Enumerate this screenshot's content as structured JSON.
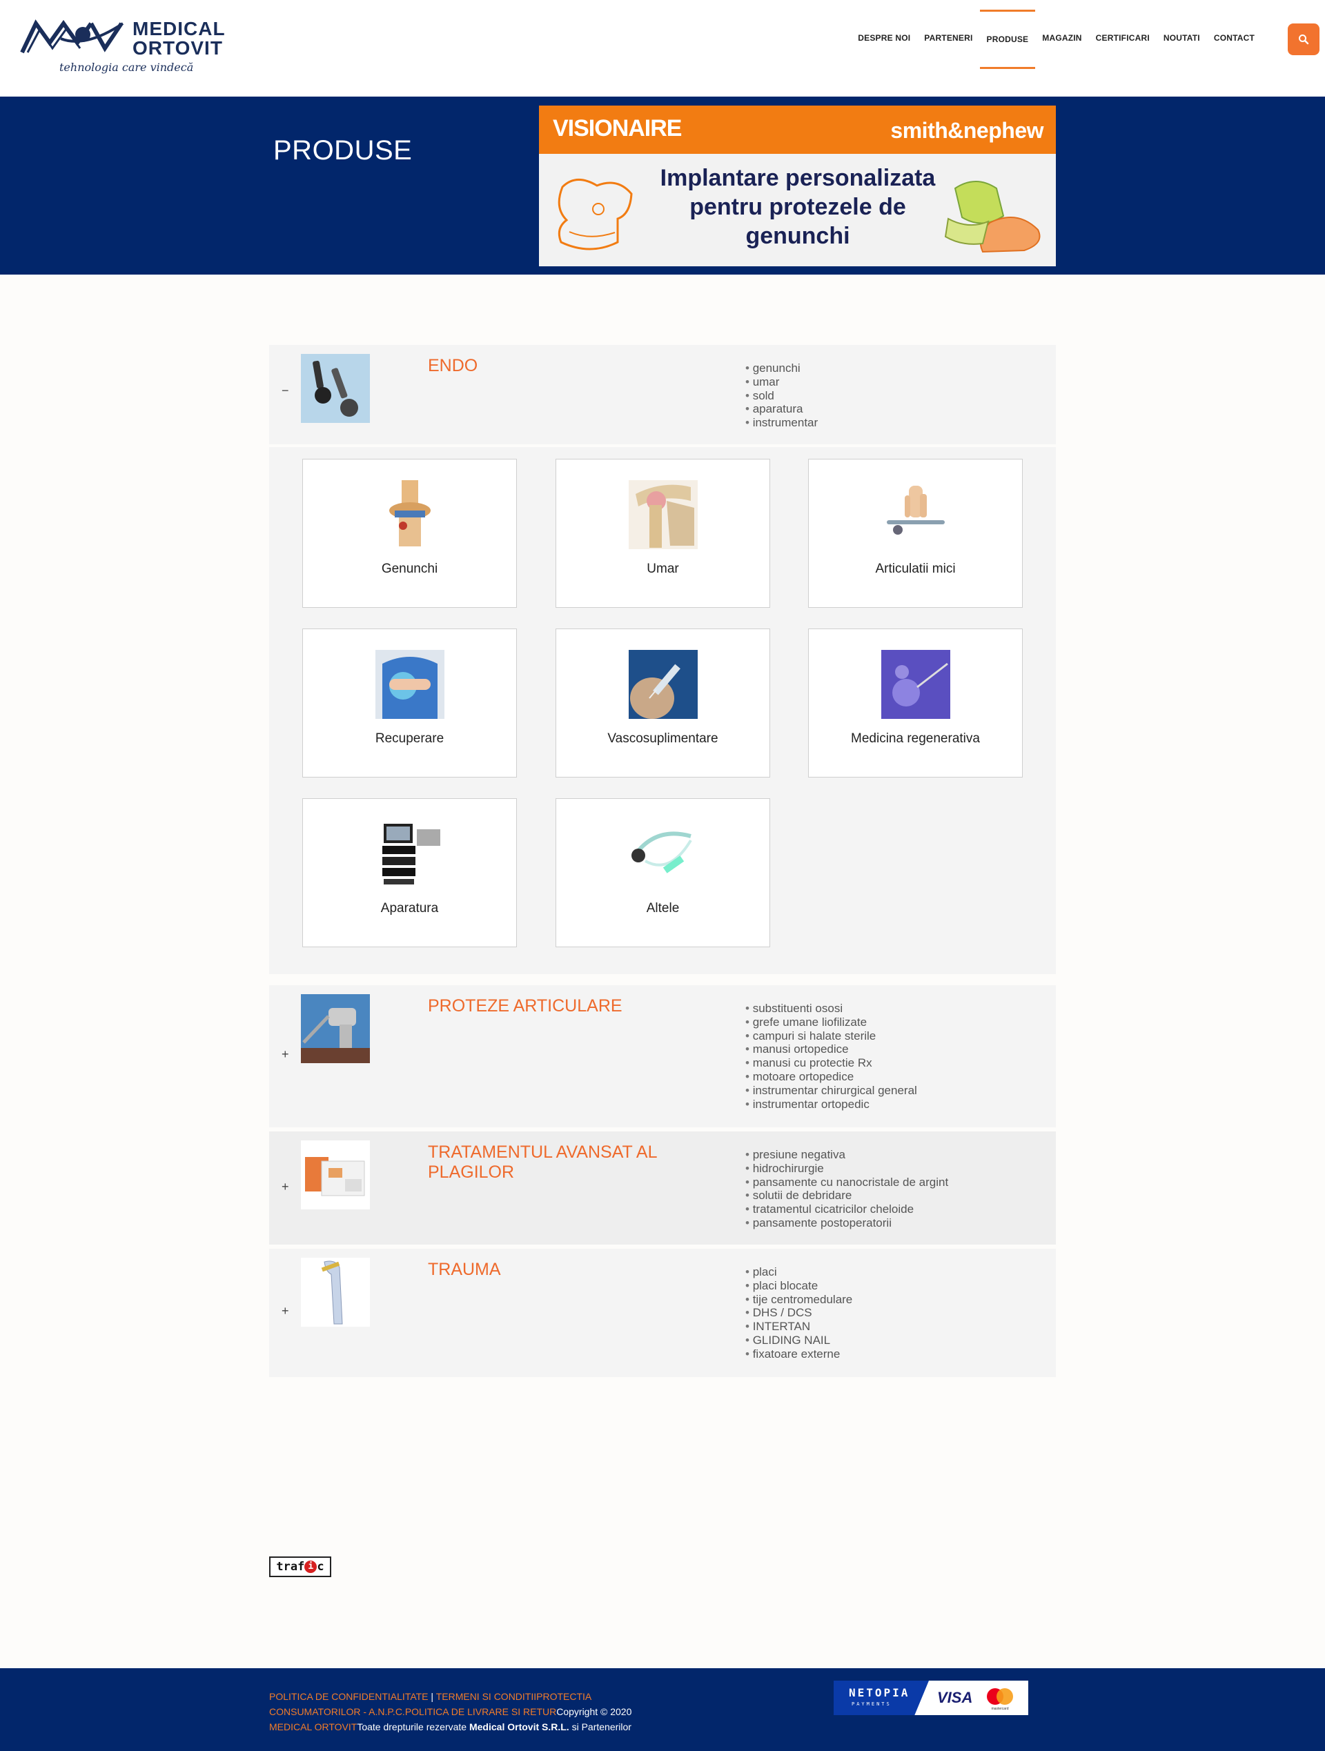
{
  "brand": {
    "name_line1": "MEDICAL",
    "name_line2": "ORTOVIT",
    "tagline": "tehnologia care vindecă"
  },
  "nav": {
    "items": [
      "DESPRE NOI",
      "PARTENERI",
      "PRODUSE",
      "MAGAZIN",
      "CERTIFICARI",
      "NOUTATI",
      "CONTACT"
    ],
    "active": "PRODUSE",
    "search_icon": "search-icon"
  },
  "banner": {
    "title": "PRODUSE",
    "promo": {
      "brand_left": "VISIONAIRE",
      "brand_right": "smith&nephew",
      "text": "Implantare personalizata pentru protezele de genunchi"
    }
  },
  "categories": [
    {
      "title": "ENDO",
      "toggle": "−",
      "expanded": true,
      "items": [
        "genunchi",
        "umar",
        "sold",
        "aparatura",
        "instrumentar"
      ],
      "subcategories": [
        "Genunchi",
        "Umar",
        "Articulatii mici",
        "Recuperare",
        "Vascosuplimentare",
        "Medicina regenerativa",
        "Aparatura",
        "Altele"
      ]
    },
    {
      "title": "PROTEZE ARTICULARE",
      "toggle": "+",
      "expanded": false,
      "items": [
        "substituenti ososi",
        "grefe umane liofilizate",
        "campuri si halate sterile",
        "manusi ortopedice",
        "manusi cu protectie Rx",
        "motoare ortopedice",
        "instrumentar chirurgical general",
        "instrumentar ortopedic"
      ]
    },
    {
      "title": "TRATAMENTUL AVANSAT AL PLAGILOR",
      "toggle": "+",
      "expanded": false,
      "items": [
        "presiune negativa",
        "hidrochirurgie",
        "pansamente cu nanocristale de argint",
        "solutii de debridare",
        "tratamentul cicatricilor cheloide",
        "pansamente postoperatorii"
      ]
    },
    {
      "title": "TRAUMA",
      "toggle": "+",
      "expanded": false,
      "items": [
        "placi",
        "placi blocate",
        "tije centromedulare",
        "DHS / DCS",
        "INTERTAN",
        "GLIDING NAIL",
        "fixatoare externe"
      ]
    }
  ],
  "trafic_badge": {
    "left": "traf",
    "dot": "i",
    "right": "c"
  },
  "footer": {
    "link_privacy": "POLITICA DE CONFIDENTIALITATE",
    "separator": "|",
    "link_terms": "TERMENI SI CONDITII",
    "link_consumer": "PROTECTIA CONSUMATORILOR - A.N.P.C.",
    "link_delivery": "POLITICA DE LIVRARE SI RETUR",
    "copyright_prefix": "Copyright © 2020",
    "company_link": "MEDICAL ORTOVIT",
    "rights_prefix": "Toate drepturile rezervate",
    "rights_company": "Medical Ortovit S.R.L.",
    "rights_suffix": "si Partenerilor",
    "payment": {
      "netopia": "NETOPIA",
      "netopia_sub": "PAYMENTS",
      "visa": "VISA",
      "mastercard": "mastercard"
    }
  },
  "colors": {
    "navy": "#02266b",
    "orange": "#ee6a2c",
    "panel": "#f4f4f4"
  }
}
